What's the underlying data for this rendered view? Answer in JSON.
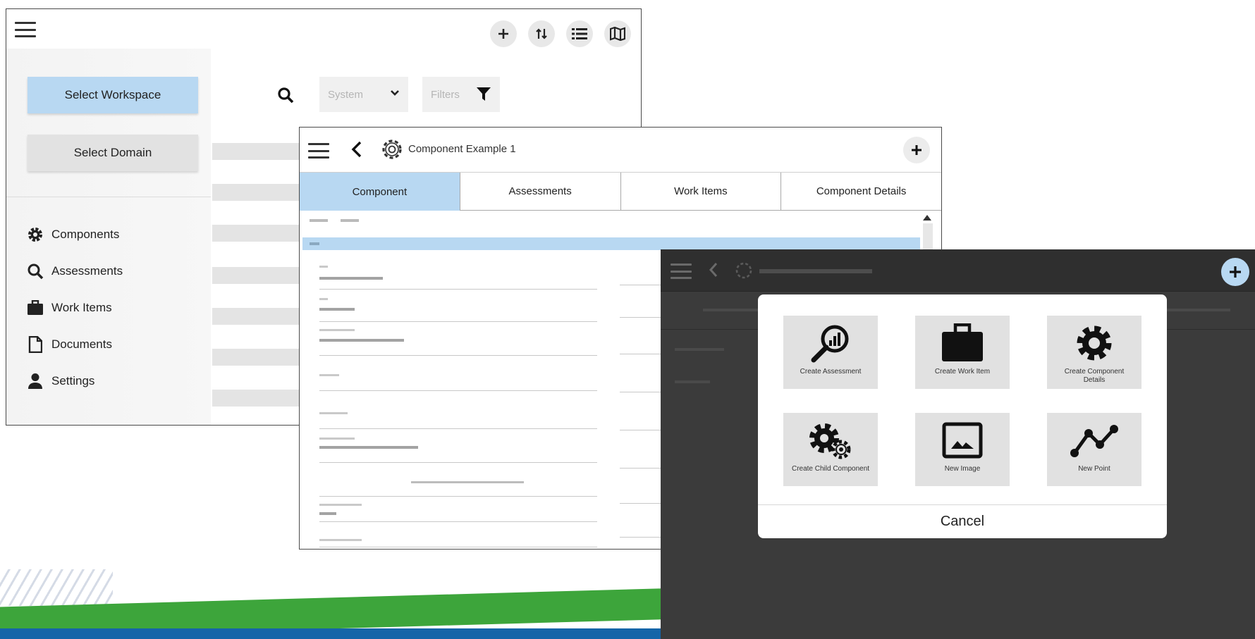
{
  "workspace_window": {
    "toolbar": {
      "add_icon": "plus-icon",
      "sort_icon": "sort-icon",
      "list_icon": "list-icon",
      "map_icon": "map-icon"
    },
    "select_workspace_label": "Select Workspace",
    "select_domain_label": "Select Domain",
    "nav_items": [
      {
        "label": "Components",
        "icon": "gear-icon"
      },
      {
        "label": "Assessments",
        "icon": "search-icon"
      },
      {
        "label": "Work Items",
        "icon": "briefcase-icon"
      },
      {
        "label": "Documents",
        "icon": "document-icon"
      },
      {
        "label": "Settings",
        "icon": "person-icon"
      }
    ],
    "filters": {
      "system_placeholder": "System",
      "filters_label": "Filters"
    }
  },
  "component_window": {
    "title": "Component Example 1",
    "tabs": [
      {
        "label": "Component",
        "active": true
      },
      {
        "label": "Assessments",
        "active": false
      },
      {
        "label": "Work Items",
        "active": false
      },
      {
        "label": "Component Details",
        "active": false
      }
    ]
  },
  "create_menu": {
    "items": [
      {
        "label": "Create Assessment",
        "icon": "assessment-icon"
      },
      {
        "label": "Create Work Item",
        "icon": "briefcase-icon"
      },
      {
        "label": "Create Component Details",
        "icon": "gear-icon"
      },
      {
        "label": "Create Child Component",
        "icon": "child-gears-icon"
      },
      {
        "label": "New Image",
        "icon": "image-icon"
      },
      {
        "label": "New Point",
        "icon": "line-point-icon"
      }
    ],
    "cancel_label": "Cancel"
  },
  "colors": {
    "accent_blue": "#b8d8f2",
    "dark_overlay": "#3b3b3b",
    "band_green": "#3da53b",
    "band_blue": "#1565a8"
  }
}
